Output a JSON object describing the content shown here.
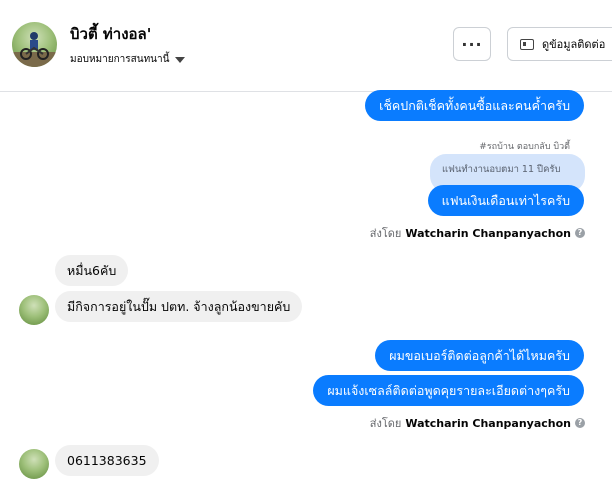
{
  "header": {
    "name": "บิวตี้ ท่างอล'",
    "assign_label": "มอบหมายการสนทนานี้",
    "more_label": "···",
    "contact_label": "ดูข้อมูลติดต่อ"
  },
  "messages": {
    "m1": "เช็คปกติเช็คทั้งคนซื้อและคนค้ำครับ",
    "reply_note": "#รถบ้าน ตอบกลับ บิวตี้",
    "quoted": "แฟนทำงานอบตมา 11 ปีครับ",
    "m2": "แฟนเงินเดือนเท่าไรครับ",
    "sent_prefix_1": "ส่งโดย",
    "sent_name_1": "Watcharin Chanpanyachon",
    "in1": "หมื่น6คับ",
    "in2": "มีกิจการอยู่ในปั๊ม ปตท. จ้างลูกน้องขายคับ",
    "m3": "ผมขอเบอร์ติดต่อลูกค้าได้ไหมครับ",
    "m4": "ผมแจ้งเซลล์ติดต่อพูดคุยรายละเอียดต่างๆครับ",
    "sent_prefix_2": "ส่งโดย",
    "sent_name_2": "Watcharin Chanpanyachon",
    "in3": "0611383635"
  }
}
